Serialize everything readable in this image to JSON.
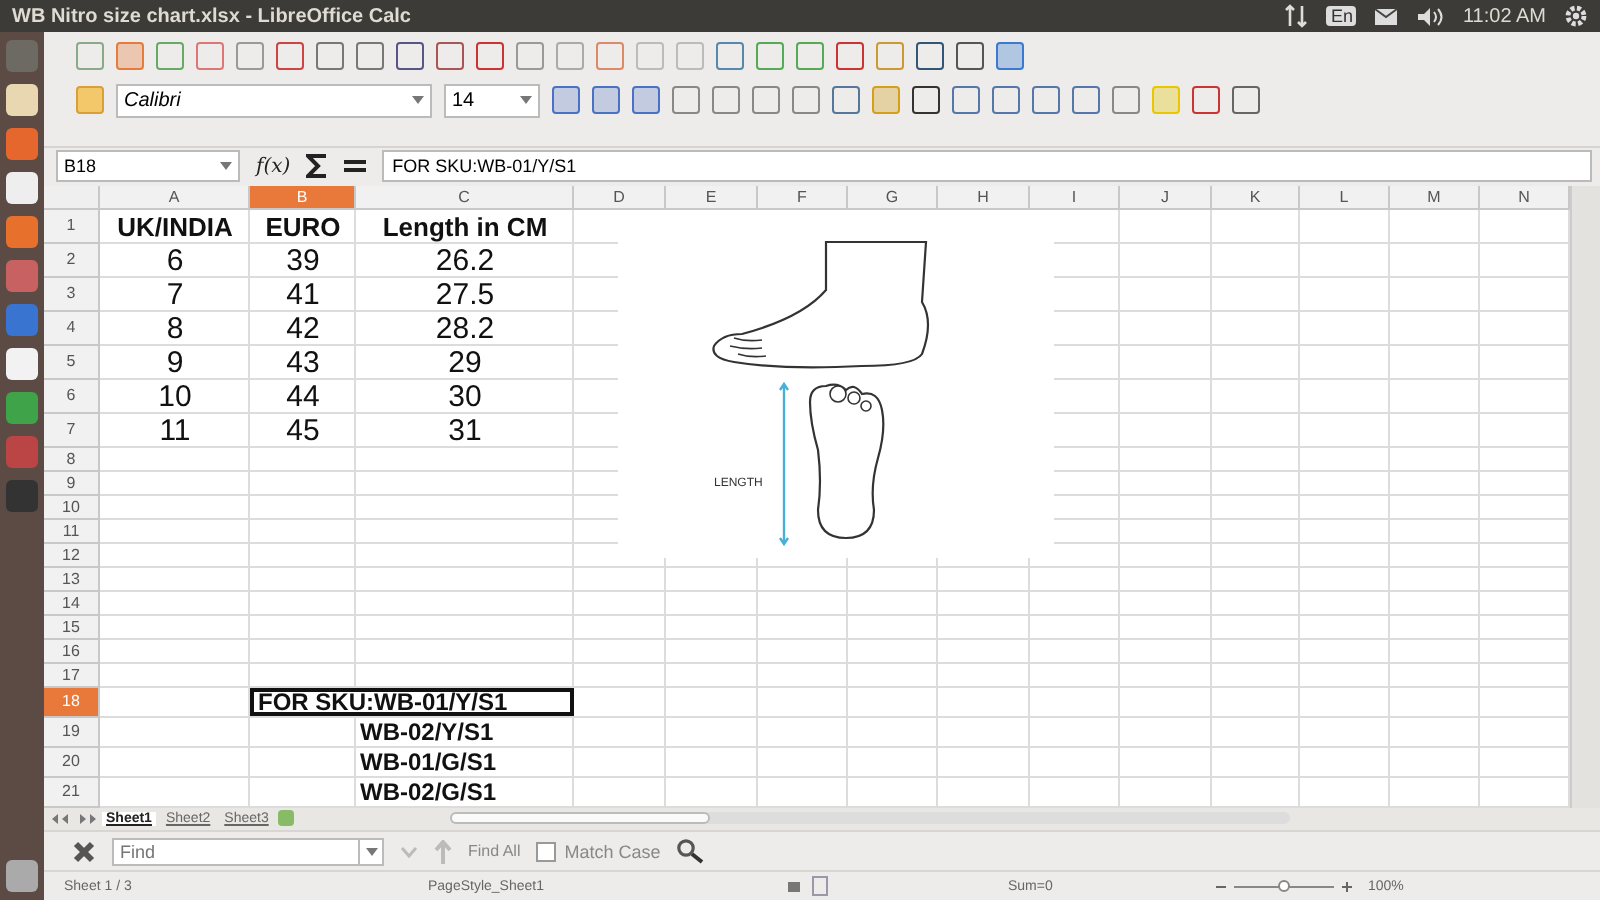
{
  "title_bar": {
    "title": "WB Nitro size chart.xlsx - LibreOffice Calc",
    "keyboard_layout": "En",
    "time": "11:02 AM"
  },
  "formatting": {
    "font_name": "Calibri",
    "font_size": "14"
  },
  "formula_bar": {
    "cell_ref": "B18",
    "function_wizard": "f(x)",
    "content": "FOR SKU:WB-01/Y/S1"
  },
  "sheet": {
    "columns": [
      {
        "label": "A",
        "selected": false
      },
      {
        "label": "B",
        "selected": true
      },
      {
        "label": "C",
        "selected": false
      },
      {
        "label": "D",
        "selected": false
      },
      {
        "label": "E",
        "selected": false
      },
      {
        "label": "F",
        "selected": false
      },
      {
        "label": "G",
        "selected": false
      },
      {
        "label": "H",
        "selected": false
      },
      {
        "label": "I",
        "selected": false
      },
      {
        "label": "J",
        "selected": false
      },
      {
        "label": "K",
        "selected": false
      },
      {
        "label": "L",
        "selected": false
      },
      {
        "label": "M",
        "selected": false
      },
      {
        "label": "N",
        "selected": false
      }
    ],
    "rows": [
      {
        "label": "1",
        "selected": false,
        "cells": [
          {
            "text": "UK/INDIA",
            "selected": false
          },
          {
            "text": "EURO",
            "selected": false
          },
          {
            "text": "Length in CM",
            "selected": false
          }
        ]
      },
      {
        "label": "2",
        "selected": false,
        "cells": [
          {
            "text": "6",
            "selected": false
          },
          {
            "text": "39",
            "selected": false
          },
          {
            "text": "26.2",
            "selected": false
          }
        ]
      },
      {
        "label": "3",
        "selected": false,
        "cells": [
          {
            "text": "7",
            "selected": false
          },
          {
            "text": "41",
            "selected": false
          },
          {
            "text": "27.5",
            "selected": false
          }
        ]
      },
      {
        "label": "4",
        "selected": false,
        "cells": [
          {
            "text": "8",
            "selected": false
          },
          {
            "text": "42",
            "selected": false
          },
          {
            "text": "28.2",
            "selected": false
          }
        ]
      },
      {
        "label": "5",
        "selected": false,
        "cells": [
          {
            "text": "9",
            "selected": false
          },
          {
            "text": "43",
            "selected": false
          },
          {
            "text": "29",
            "selected": false
          }
        ]
      },
      {
        "label": "6",
        "selected": false,
        "cells": [
          {
            "text": "10",
            "selected": false
          },
          {
            "text": "44",
            "selected": false
          },
          {
            "text": "30",
            "selected": false
          }
        ]
      },
      {
        "label": "7",
        "selected": false,
        "cells": [
          {
            "text": "11",
            "selected": false
          },
          {
            "text": "45",
            "selected": false
          },
          {
            "text": "31",
            "selected": false
          }
        ]
      },
      {
        "label": "8",
        "selected": false
      },
      {
        "label": "9",
        "selected": false
      },
      {
        "label": "10",
        "selected": false
      },
      {
        "label": "11",
        "selected": false
      },
      {
        "label": "12",
        "selected": false
      },
      {
        "label": "13",
        "selected": false
      },
      {
        "label": "14",
        "selected": false
      },
      {
        "label": "15",
        "selected": false
      },
      {
        "label": "16",
        "selected": false
      },
      {
        "label": "17",
        "selected": false
      },
      {
        "label": "18",
        "selected": true,
        "cells": [
          null,
          {
            "text": "FOR SKU:WB-01/Y/S1",
            "selected": true
          }
        ]
      },
      {
        "label": "19",
        "selected": false,
        "cells": [
          null,
          null,
          {
            "text": "WB-02/Y/S1",
            "selected": false
          }
        ]
      },
      {
        "label": "20",
        "selected": false,
        "cells": [
          null,
          null,
          {
            "text": "WB-01/G/S1",
            "selected": false
          }
        ]
      },
      {
        "label": "21",
        "selected": false,
        "cells": [
          null,
          null,
          {
            "text": "WB-02/G/S1",
            "selected": false
          }
        ]
      }
    ],
    "image": {
      "label": "LENGTH"
    }
  },
  "sheet_tabs": [
    {
      "label": "Sheet1",
      "selected": true
    },
    {
      "label": "Sheet2",
      "selected": false
    },
    {
      "label": "Sheet3",
      "selected": false
    }
  ],
  "find_bar": {
    "placeholder": "Find",
    "find_all": "Find All",
    "match_case": {
      "label": "Match Case",
      "checked": false
    }
  },
  "status_bar": {
    "sheet": "Sheet 1 / 3",
    "page_style": "PageStyle_Sheet1",
    "sum": "Sum=0",
    "zoom": {
      "level": 0.5,
      "reading": "100%"
    }
  }
}
